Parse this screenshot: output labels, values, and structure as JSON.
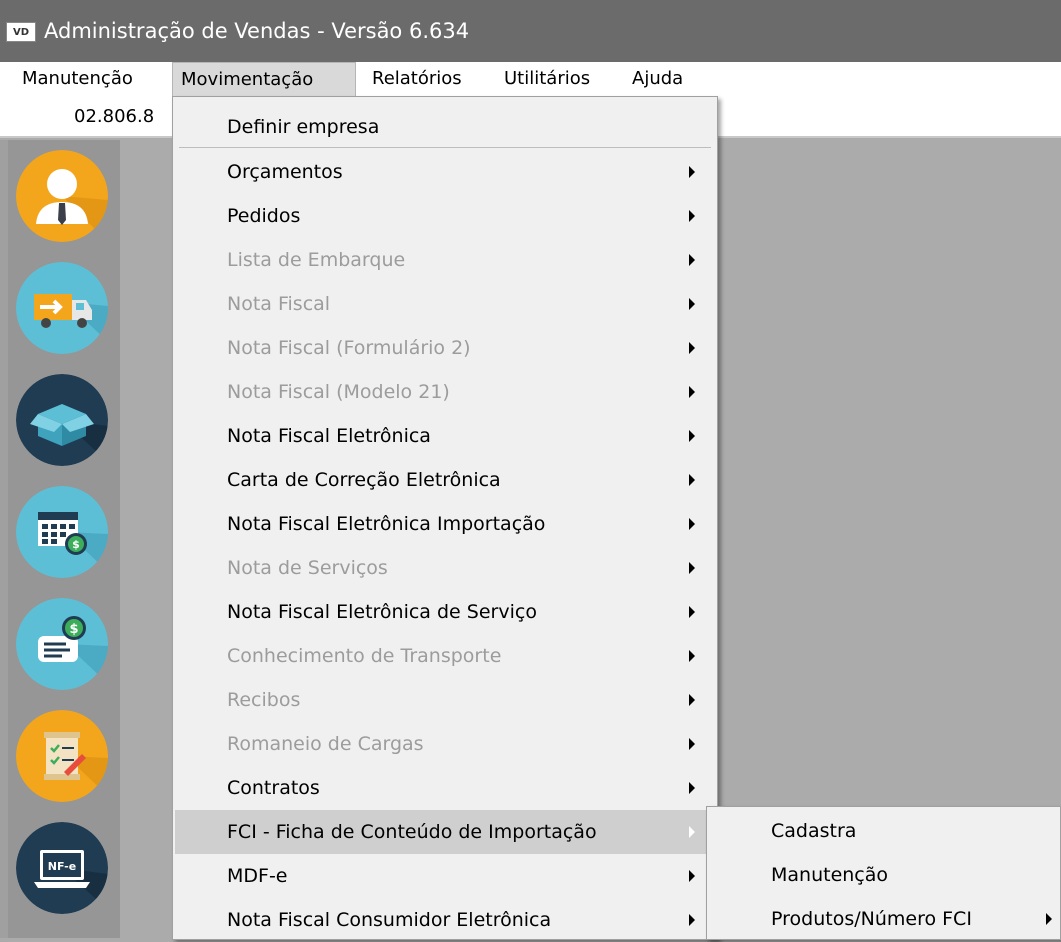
{
  "window": {
    "icon_text": "VD",
    "title": "Administração de Vendas - Versão 6.634"
  },
  "menubar": {
    "items": [
      {
        "label": "Manutenção"
      },
      {
        "label": "Movimentação"
      },
      {
        "label": "Relatórios"
      },
      {
        "label": "Utilitários"
      },
      {
        "label": "Ajuda"
      }
    ]
  },
  "infobar": {
    "code": "02.806.8"
  },
  "sidebar": {
    "icons": [
      "person-icon",
      "delivery-truck-icon",
      "box-icon",
      "calendar-money-icon",
      "invoice-money-icon",
      "checklist-icon",
      "nfe-laptop-icon"
    ]
  },
  "movimentacao_menu": {
    "items": [
      {
        "label": "Definir empresa",
        "enabled": true,
        "submenu": false
      },
      {
        "label": "Orçamentos",
        "enabled": true,
        "submenu": true
      },
      {
        "label": "Pedidos",
        "enabled": true,
        "submenu": true
      },
      {
        "label": "Lista de Embarque",
        "enabled": false,
        "submenu": true
      },
      {
        "label": "Nota Fiscal",
        "enabled": false,
        "submenu": true
      },
      {
        "label": "Nota Fiscal (Formulário 2)",
        "enabled": false,
        "submenu": true
      },
      {
        "label": "Nota Fiscal (Modelo 21)",
        "enabled": false,
        "submenu": true
      },
      {
        "label": "Nota Fiscal Eletrônica",
        "enabled": true,
        "submenu": true
      },
      {
        "label": "Carta de Correção Eletrônica",
        "enabled": true,
        "submenu": true
      },
      {
        "label": "Nota Fiscal Eletrônica Importação",
        "enabled": true,
        "submenu": true
      },
      {
        "label": "Nota de Serviços",
        "enabled": false,
        "submenu": true
      },
      {
        "label": "Nota Fiscal Eletrônica de Serviço",
        "enabled": true,
        "submenu": true
      },
      {
        "label": "Conhecimento de Transporte",
        "enabled": false,
        "submenu": true
      },
      {
        "label": "Recibos",
        "enabled": false,
        "submenu": true
      },
      {
        "label": "Romaneio de Cargas",
        "enabled": false,
        "submenu": true
      },
      {
        "label": "Contratos",
        "enabled": true,
        "submenu": true
      },
      {
        "label": "FCI - Ficha de Conteúdo de Importação",
        "enabled": true,
        "submenu": true,
        "highlighted": true
      },
      {
        "label": "MDF-e",
        "enabled": true,
        "submenu": true
      },
      {
        "label": "Nota Fiscal Consumidor Eletrônica",
        "enabled": true,
        "submenu": true
      }
    ]
  },
  "fci_submenu": {
    "items": [
      {
        "label": "Cadastra",
        "submenu": false
      },
      {
        "label": "Manutenção",
        "submenu": false
      },
      {
        "label": "Produtos/Número FCI",
        "submenu": true
      }
    ]
  },
  "colors": {
    "titlebar": "#6b6b6b",
    "menu_bg": "#f0f0f0",
    "highlight": "#cfcfcf",
    "disabled_text": "#9c9c9c",
    "sidebar": "#969696"
  }
}
